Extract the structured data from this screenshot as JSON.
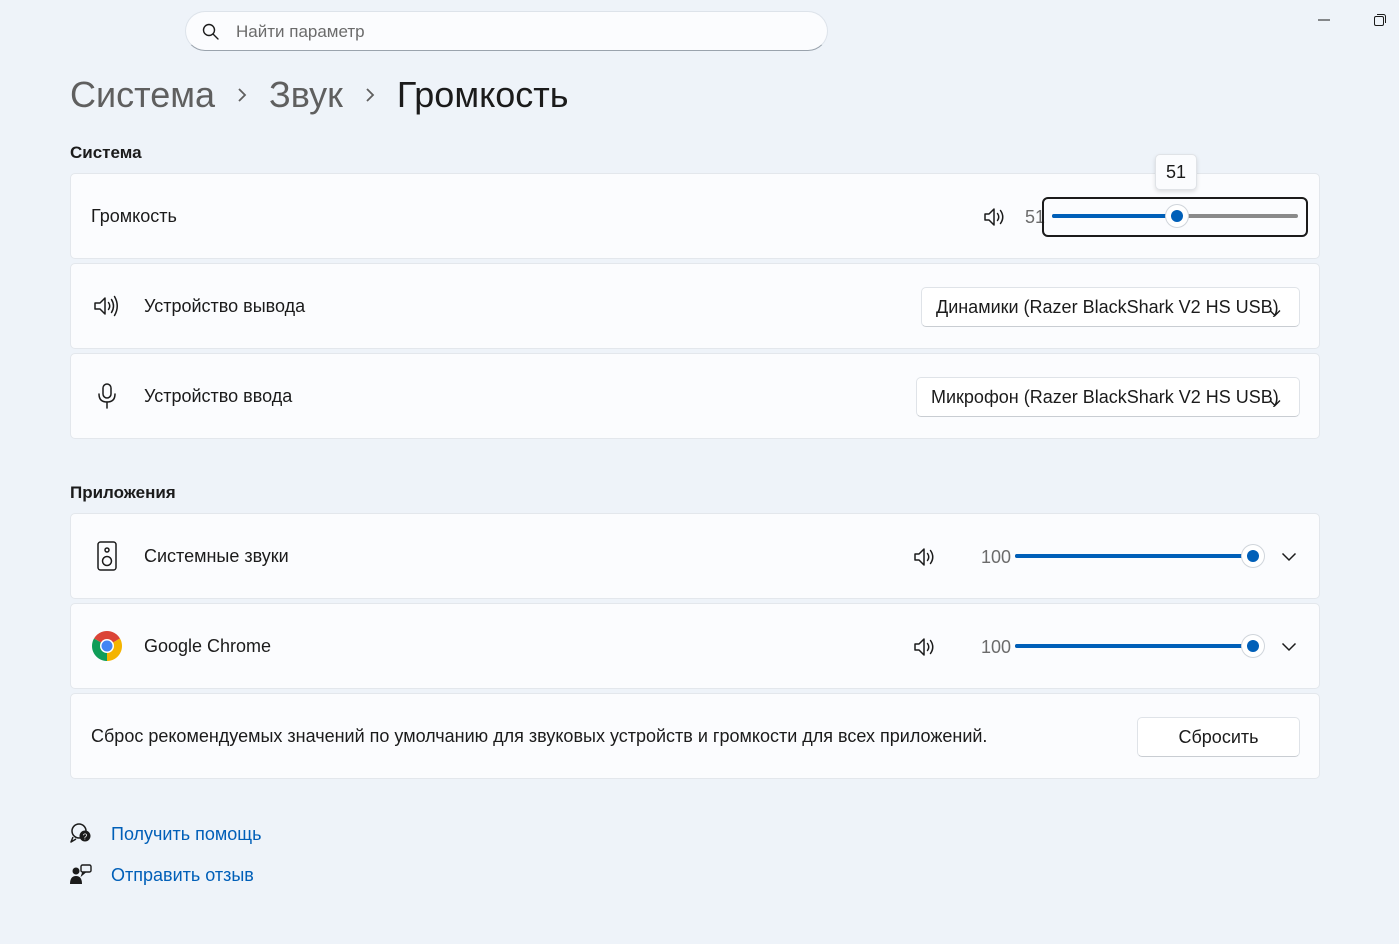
{
  "search": {
    "placeholder": "Найти параметр"
  },
  "breadcrumb": [
    "Система",
    "Звук",
    "Громкость"
  ],
  "sections": {
    "system": "Система",
    "apps": "Приложения"
  },
  "system": {
    "volume": {
      "label": "Громкость",
      "value": "51",
      "tooltip": "51",
      "level": 51,
      "icon": "speaker-icon"
    },
    "output": {
      "label": "Устройство вывода",
      "selected": "Динамики (Razer BlackShark V2 HS USB)",
      "icon": "speaker-icon"
    },
    "input": {
      "label": "Устройство ввода",
      "selected": "Микрофон (Razer BlackShark V2 HS USB)",
      "icon": "microphone-icon"
    }
  },
  "apps": [
    {
      "name": "Системные звуки",
      "value": "100",
      "level": 100,
      "icon": "system-sounds-icon"
    },
    {
      "name": "Google Chrome",
      "value": "100",
      "level": 100,
      "icon": "chrome-icon"
    }
  ],
  "reset": {
    "text": "Сброс рекомендуемых значений по умолчанию для звуковых устройств и громкости для всех приложений.",
    "button": "Сбросить"
  },
  "links": {
    "help": "Получить помощь",
    "feedback": "Отправить отзыв"
  },
  "colors": {
    "accent": "#005fb8",
    "background": "#eef3f9",
    "card": "#fbfcfe"
  }
}
